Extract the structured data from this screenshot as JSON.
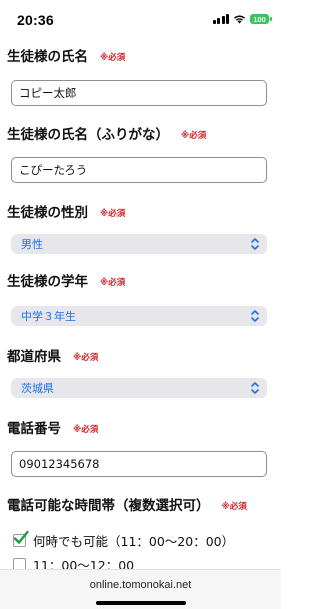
{
  "status_bar": {
    "time": "20:36",
    "battery": "100",
    "battery_color": "#34c759"
  },
  "form": {
    "required_mark": "※必須",
    "name": {
      "label": "生徒様の氏名",
      "value": "コピー太郎"
    },
    "name_kana": {
      "label": "生徒様の氏名（ふりがな）",
      "value": "こぴーたろう"
    },
    "gender": {
      "label": "生徒様の性別",
      "selected": "男性"
    },
    "grade": {
      "label": "生徒様の学年",
      "selected": "中学３年生"
    },
    "prefecture": {
      "label": "都道府県",
      "selected": "茨城県"
    },
    "phone": {
      "label": "電話番号",
      "value": "09012345678"
    },
    "contact_time": {
      "label": "電話可能な時間帯（複数選択可）",
      "options": [
        {
          "label": "何時でも可能（11：00〜20：00）",
          "checked": true
        },
        {
          "label": "11：00〜12：00",
          "checked": false
        }
      ]
    }
  },
  "browser": {
    "url": "online.tomonokai.net"
  },
  "colors": {
    "required": "#d2232a",
    "select_text": "#1a73e8",
    "check_green": "#1e9e3a"
  }
}
